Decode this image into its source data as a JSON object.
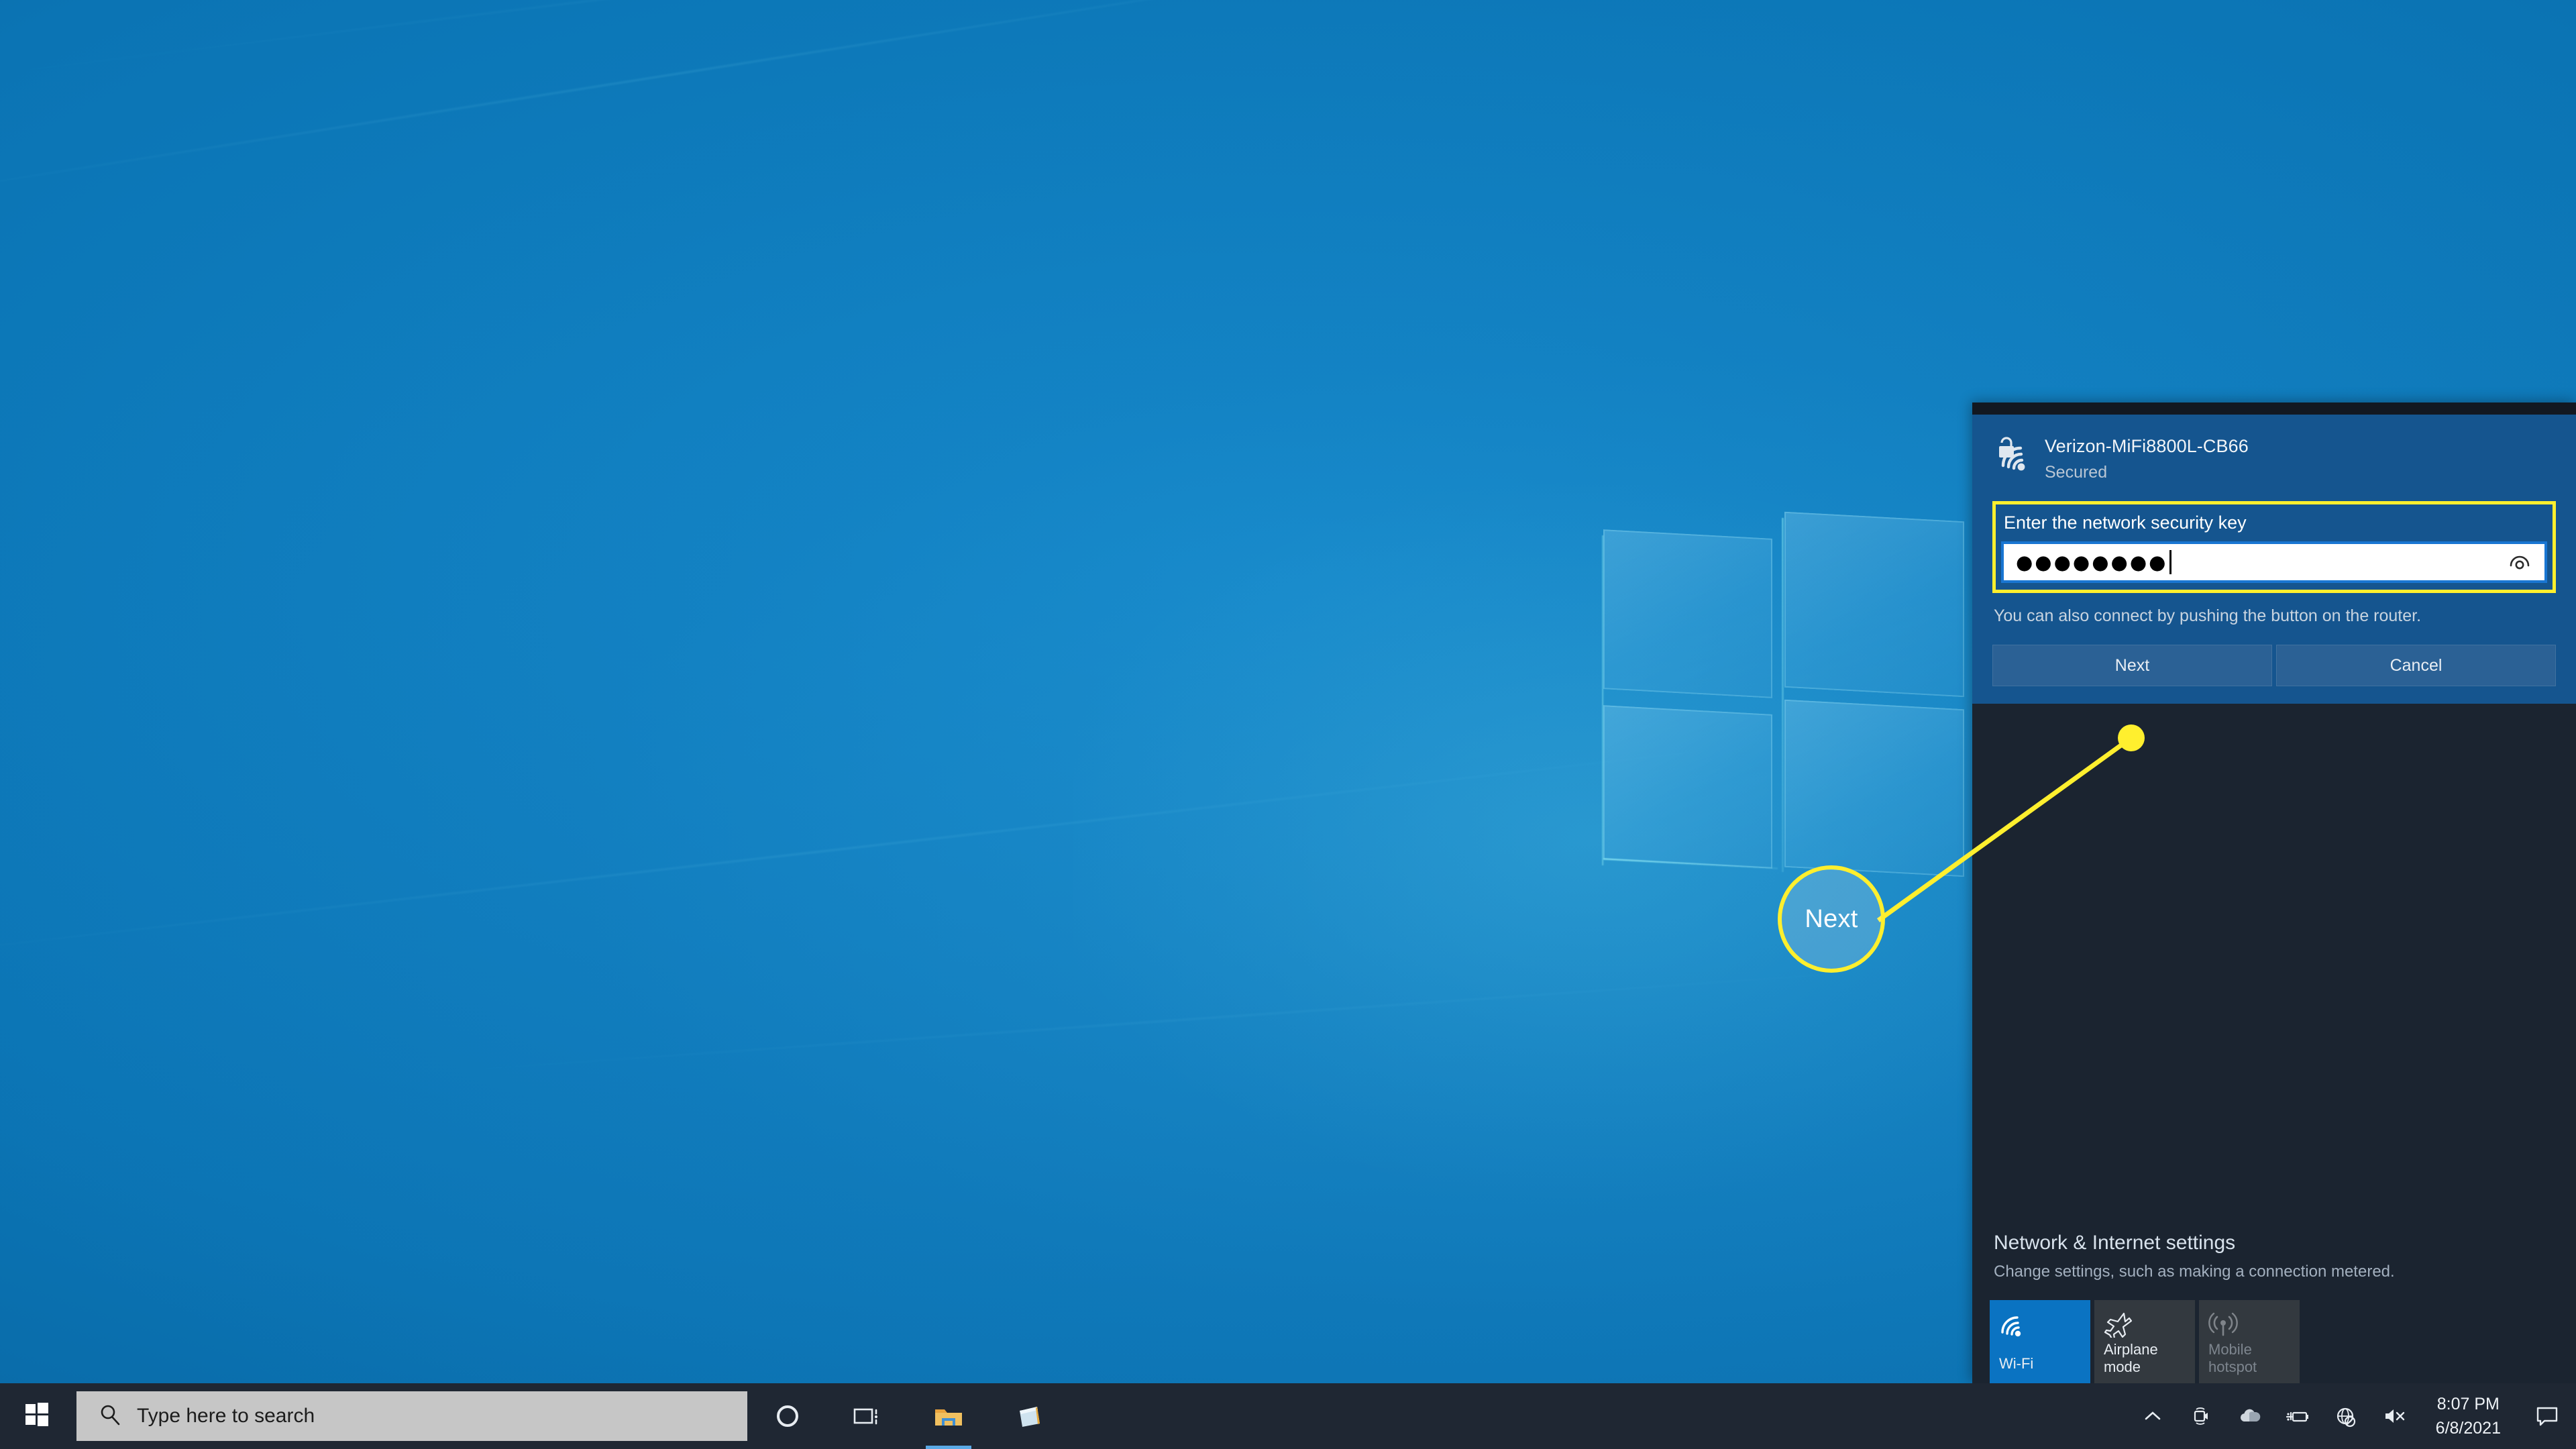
{
  "wifi_panel": {
    "network": {
      "ssid": "Verizon-MiFi8800L-CB66",
      "status": "Secured",
      "icon": "wifi-locked-icon"
    },
    "password": {
      "label": "Enter the network security key",
      "value_mask": "●●●●●●●●",
      "reveal_icon": "eye-icon"
    },
    "hint": "You can also connect by pushing the button on the router.",
    "buttons": {
      "next": "Next",
      "cancel": "Cancel"
    },
    "settings": {
      "title": "Network & Internet settings",
      "subtitle": "Change settings, such as making a connection metered."
    },
    "tiles": [
      {
        "label": "Wi-Fi",
        "icon": "wifi-icon",
        "state": "on"
      },
      {
        "label": "Airplane mode",
        "icon": "airplane-icon",
        "state": "off"
      },
      {
        "label": "Mobile hotspot",
        "icon": "hotspot-icon",
        "state": "dim"
      }
    ]
  },
  "annotation": {
    "label": "Next",
    "color": "#ffef2e"
  },
  "taskbar": {
    "start_icon": "windows-start-icon",
    "search": {
      "placeholder": "Type here to search",
      "icon": "search-icon"
    },
    "apps": [
      {
        "name": "cortana-icon",
        "label": "Cortana",
        "active": false
      },
      {
        "name": "task-view-icon",
        "label": "Task View",
        "active": false
      },
      {
        "name": "file-explorer-icon",
        "label": "File Explorer",
        "active": true
      },
      {
        "name": "sticky-notes-icon",
        "label": "Sticky Notes",
        "active": false
      }
    ],
    "tray": [
      {
        "name": "show-hidden-icons-chevron",
        "label": "Show hidden icons"
      },
      {
        "name": "camera-icon",
        "label": "Camera"
      },
      {
        "name": "onedrive-icon",
        "label": "OneDrive"
      },
      {
        "name": "battery-charging-icon",
        "label": "Battery charging"
      },
      {
        "name": "network-no-internet-icon",
        "label": "No Internet access"
      },
      {
        "name": "volume-muted-icon",
        "label": "Volume muted"
      }
    ],
    "clock": {
      "time": "8:07 PM",
      "date": "6/8/2021"
    },
    "action_center_icon": "action-center-icon"
  }
}
